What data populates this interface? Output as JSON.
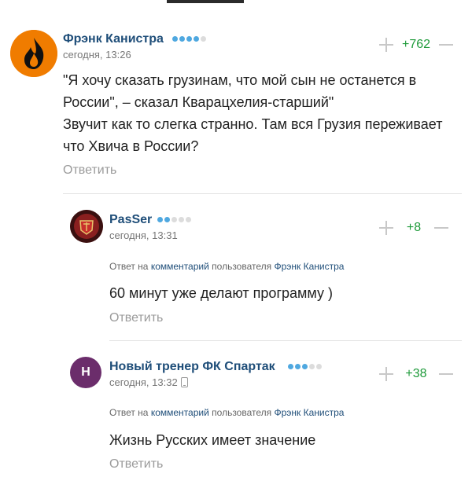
{
  "comments": [
    {
      "author": "Фрэнк Канистра",
      "date": "сегодня, 13:26",
      "score": "+762",
      "text_lines": [
        "\"Я хочу сказать грузинам, что мой сын не останется в",
        "России\", – сказал Кварацхелия-старший\"",
        "Звучит как то слегка странно. Там вся Грузия переживает",
        "что Хвича в России?"
      ],
      "reply_label": "Ответить",
      "avatar_icon": "fire-icon",
      "rating_dots_on": 4,
      "rating_dots_total": 5
    },
    {
      "author": "PasSer",
      "date": "сегодня, 13:31",
      "score": "+8",
      "reply_to": {
        "prefix": "Ответ на",
        "link": "комментарий",
        "middle": "пользователя",
        "user": "Фрэнк Канистра"
      },
      "text": "60 минут уже делают программу )",
      "reply_label": "Ответить",
      "avatar_icon": "club-crest-icon",
      "rating_dots_on": 2,
      "rating_dots_total": 5
    },
    {
      "author": "Новый тренер ФК Спартак",
      "date": "сегодня, 13:32",
      "score": "+38",
      "reply_to": {
        "prefix": "Ответ на",
        "link": "комментарий",
        "middle": "пользователя",
        "user": "Фрэнк Канистра"
      },
      "text": "Жизнь Русских имеет значение",
      "reply_label": "Ответить",
      "avatar_letter": "Н",
      "avatar_color": "#6b2d6b",
      "rating_dots_on": 3,
      "rating_dots_total": 5
    }
  ],
  "colors": {
    "author": "#1f4e79",
    "score": "#1e9a3a",
    "dot_on": "#4fa8e0",
    "dot_off": "#dcdcdc"
  }
}
